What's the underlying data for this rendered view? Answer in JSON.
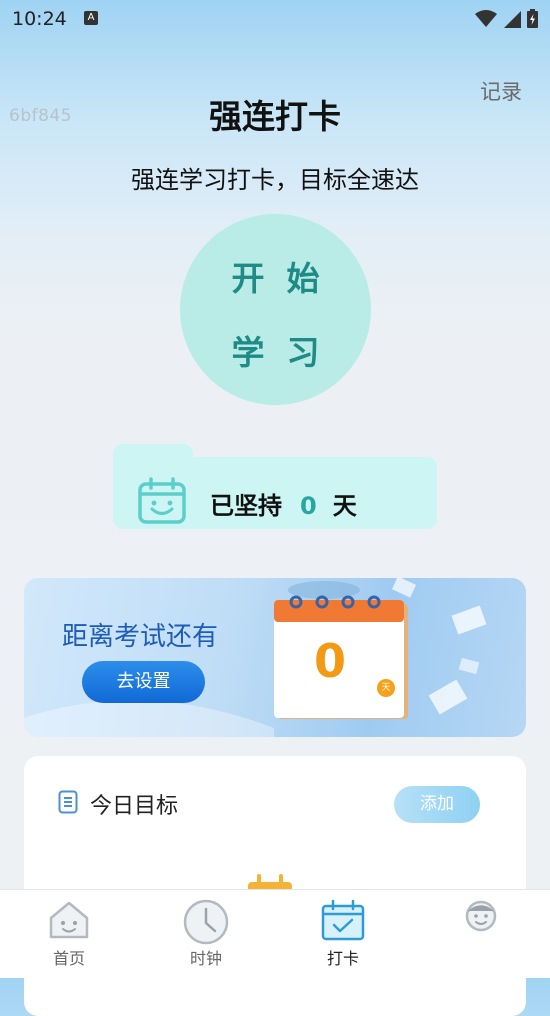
{
  "status_bar": {
    "time": "10:24",
    "notification_badge": "A"
  },
  "watermark": "6bf845",
  "header": {
    "title": "强连打卡",
    "record_link": "记录"
  },
  "subtitle": "强连学习打卡，目标全速达",
  "start_button": {
    "line1": "开始",
    "line2": "学习"
  },
  "streak": {
    "prefix": "已坚持",
    "count": "0",
    "unit": "天"
  },
  "exam": {
    "title": "距离考试还有",
    "button_label": "去设置",
    "days": "0",
    "unit": "天"
  },
  "goals": {
    "title": "今日目标",
    "add_label": "添加"
  },
  "tabbar": {
    "items": [
      {
        "label": "首页",
        "icon": "home-icon"
      },
      {
        "label": "时钟",
        "icon": "clock-icon"
      },
      {
        "label": "打卡",
        "icon": "calendar-check-icon",
        "active": true
      },
      {
        "label": "",
        "icon": "face-icon"
      }
    ]
  },
  "colors": {
    "accent_teal": "#28a7a0",
    "start_circle": "#b9ece6",
    "streak_card": "#ccf5f3",
    "exam_button": "#1169d6",
    "calendar_orange": "#f39a14"
  }
}
